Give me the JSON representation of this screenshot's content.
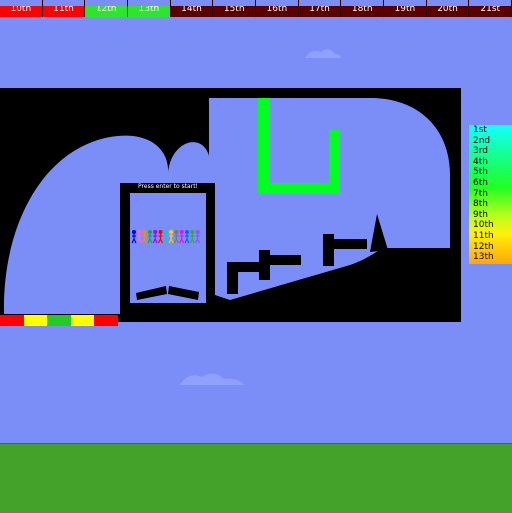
{
  "top_bar": {
    "places": [
      {
        "label": "10th",
        "color": "#ff0000"
      },
      {
        "label": "11th",
        "color": "#ff0000"
      },
      {
        "label": "12th",
        "color": "#2ee52e"
      },
      {
        "label": "13th",
        "color": "#2ee52e"
      },
      {
        "label": "14th",
        "color": "#5a0000"
      },
      {
        "label": "15th",
        "color": "#5a0000"
      },
      {
        "label": "16th",
        "color": "#5a0000"
      },
      {
        "label": "17th",
        "color": "#5a0000"
      },
      {
        "label": "18th",
        "color": "#5a0000"
      },
      {
        "label": "19th",
        "color": "#5a0000"
      },
      {
        "label": "20th",
        "color": "#5a0000"
      },
      {
        "label": "21st",
        "color": "#5a0000"
      }
    ]
  },
  "start_prompt": "Press enter to start!",
  "ranking_panel": {
    "places": [
      "1st",
      "2nd",
      "3rd",
      "4th",
      "5th",
      "6th",
      "7th",
      "8th",
      "9th",
      "10th",
      "11th",
      "12th",
      "13th"
    ]
  },
  "start_stripe_colors": [
    "#ff0000",
    "#ffff00",
    "#22cc22",
    "#ffff00",
    "#ff0000"
  ],
  "runner_colors": [
    "#0000ff",
    "#ff66cc",
    "#ff8800",
    "#00aa55",
    "#aa00ff",
    "#ff0000",
    "#00cccc",
    "#ffcc00",
    "#777777",
    "#ff00ff",
    "#0066ff",
    "#33aa33",
    "#8855ff"
  ],
  "colors": {
    "sky": "#7b8ef8",
    "track": "#000000",
    "ground": "#44a12a",
    "goal_bracket": "#00ff1e"
  }
}
